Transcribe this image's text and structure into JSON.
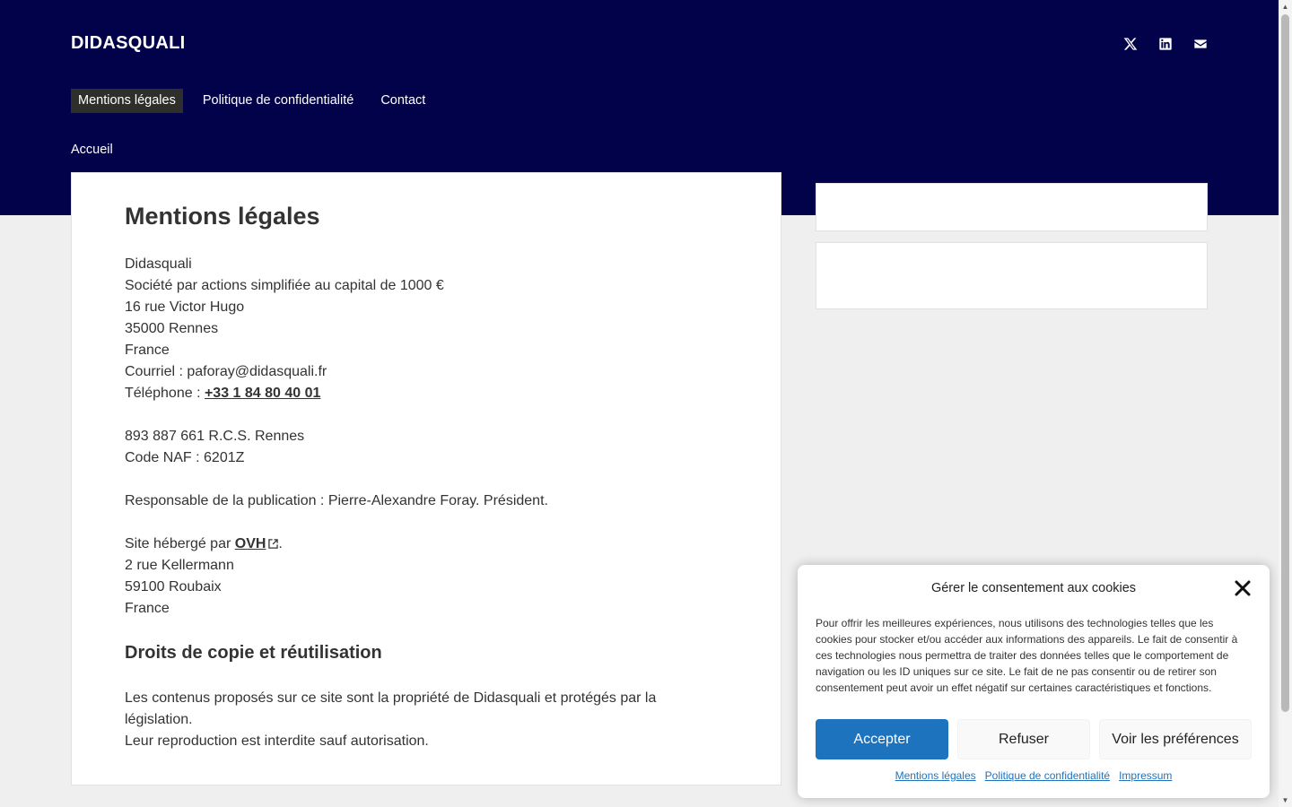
{
  "site": {
    "logo": "DIDASQUALI"
  },
  "social": [
    {
      "name": "x-icon"
    },
    {
      "name": "linkedin-icon"
    },
    {
      "name": "email-icon"
    }
  ],
  "nav": [
    {
      "label": "Mentions légales",
      "active": true
    },
    {
      "label": "Politique de confidentialité",
      "active": false
    },
    {
      "label": "Contact",
      "active": false
    }
  ],
  "breadcrumb": "Accueil",
  "page": {
    "title": "Mentions légales",
    "lines1": [
      "Didasquali",
      "Société par actions simplifiée au capital de 1000 €",
      "16 rue Victor Hugo",
      "35000 Rennes",
      "France",
      "Courriel : paforay@didasquali.fr"
    ],
    "phone_prefix": "Téléphone : ",
    "phone": "+33 1 84 80 40 01",
    "lines2": [
      "893 887 661 R.C.S. Rennes",
      "Code NAF : 6201Z"
    ],
    "publication": "Responsable de la publication : Pierre-Alexandre Foray. Président.",
    "host_prefix": "Site hébergé par ",
    "host": "OVH",
    "host_suffix": ".",
    "host_lines": [
      "2 rue Kellermann",
      "59100 Roubaix",
      "France"
    ],
    "section_title": "Droits de copie et réutilisation",
    "rights_lines": [
      "Les contenus proposés sur ce site sont la propriété de Didasquali et protégés par la législation.",
      "Leur reproduction est interdite sauf autorisation."
    ]
  },
  "cookie": {
    "title": "Gérer le consentement aux cookies",
    "text": "Pour offrir les meilleures expériences, nous utilisons des technologies telles que les cookies pour stocker et/ou accéder aux informations des appareils. Le fait de consentir à ces technologies nous permettra de traiter des données telles que le comportement de navigation ou les ID uniques sur ce site. Le fait de ne pas consentir ou de retirer son consentement peut avoir un effet négatif sur certaines caractéristiques et fonctions.",
    "accept": "Accepter",
    "refuse": "Refuser",
    "prefs": "Voir les préférences",
    "links": [
      "Mentions légales",
      "Politique de confidentialité",
      "Impressum"
    ]
  },
  "colors": {
    "header_bg": "#02024a",
    "accent": "#1e73be",
    "active_nav": "#2e2e2a"
  }
}
